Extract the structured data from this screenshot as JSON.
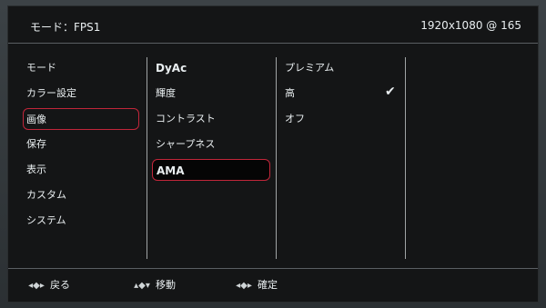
{
  "header": {
    "mode_label": "モード：FPS1",
    "resolution": "1920x1080 @ 165"
  },
  "menu": {
    "main": [
      {
        "label": "モード"
      },
      {
        "label": "カラー設定"
      },
      {
        "label": "画像"
      },
      {
        "label": "保存"
      },
      {
        "label": "表示"
      },
      {
        "label": "カスタム"
      },
      {
        "label": "システム"
      }
    ],
    "sub": [
      {
        "label": "DyAc"
      },
      {
        "label": "輝度"
      },
      {
        "label": "コントラスト"
      },
      {
        "label": "シャープネス"
      },
      {
        "label": "AMA"
      }
    ],
    "options": [
      {
        "label": "プレミアム"
      },
      {
        "label": "高"
      },
      {
        "label": "オフ"
      }
    ],
    "checkmark": "✔"
  },
  "footer": {
    "back": {
      "label": "戻る",
      "icon": "◂◆▸"
    },
    "move": {
      "label": "移動",
      "icon": "▴◆▾"
    },
    "confirm": {
      "label": "確定",
      "icon": "◂◆▸"
    }
  }
}
